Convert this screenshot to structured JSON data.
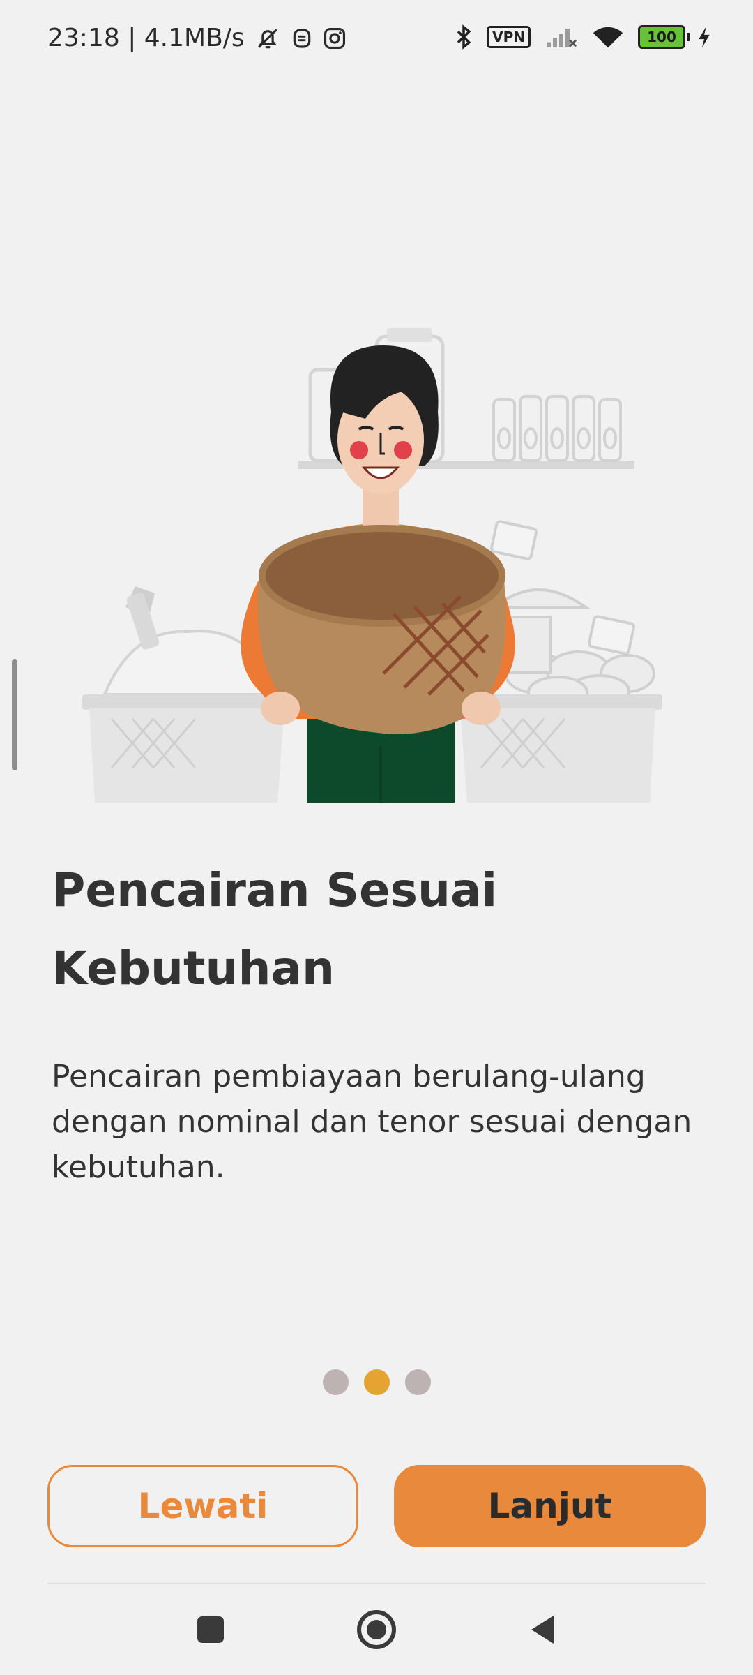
{
  "status_bar": {
    "time_speed": "23:18 | 4.1MB/s",
    "icons": [
      "bell-off-icon",
      "alarm-icon",
      "instagram-icon",
      "bluetooth-icon",
      "vpn-badge",
      "signal-icon",
      "wifi-icon",
      "battery-icon",
      "charging-icon"
    ],
    "vpn_label": "VPN",
    "battery_level": "100",
    "battery_color": "#67c23a"
  },
  "onboarding": {
    "illustration": "woman-holding-basket-market-illustration",
    "title": "Pencairan Sesuai Kebutuhan",
    "description": "Pencairan pembiayaan berulang-ulang dengan nominal dan tenor sesuai dengan kebutuhan.",
    "page_count": 3,
    "current_page": 2
  },
  "buttons": {
    "skip_label": "Lewati",
    "next_label": "Lanjut"
  },
  "colors": {
    "accent": "#e8893b",
    "dot_active": "#e5a332",
    "dot_inactive": "#bdb3b3",
    "background": "#f1f1f1"
  },
  "nav_bar": {
    "icons": [
      "recents-square-icon",
      "home-circle-icon",
      "back-triangle-icon"
    ]
  }
}
